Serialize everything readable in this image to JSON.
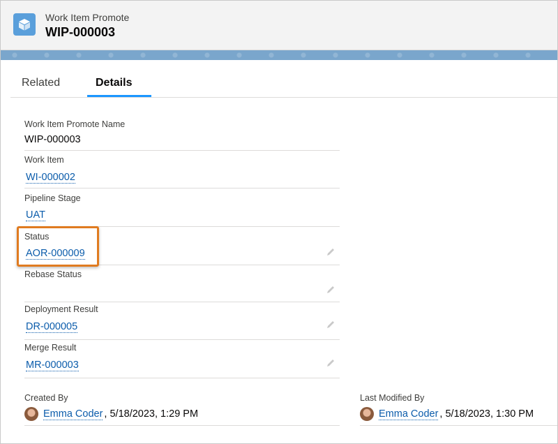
{
  "header": {
    "object_type": "Work Item Promote",
    "record_title": "WIP-000003"
  },
  "tabs": {
    "related": "Related",
    "details": "Details"
  },
  "fields": {
    "name": {
      "label": "Work Item Promote Name",
      "value": "WIP-000003"
    },
    "work_item": {
      "label": "Work Item",
      "value": "WI-000002"
    },
    "pipeline_stage": {
      "label": "Pipeline Stage",
      "value": "UAT"
    },
    "status": {
      "label": "Status",
      "value": "AOR-000009"
    },
    "rebase_status": {
      "label": "Rebase Status",
      "value": ""
    },
    "deployment_result": {
      "label": "Deployment Result",
      "value": "DR-000005"
    },
    "merge_result": {
      "label": "Merge Result",
      "value": "MR-000003"
    }
  },
  "created_by": {
    "label": "Created By",
    "user": "Emma Coder",
    "date": ", 5/18/2023, 1:29 PM"
  },
  "last_modified_by": {
    "label": "Last Modified By",
    "user": "Emma Coder",
    "date": ", 5/18/2023, 1:30 PM"
  },
  "colors": {
    "accent": "#1b96ff",
    "link": "#0b5cab",
    "highlight": "#e07b20",
    "icon_bg": "#5a9fdb"
  },
  "icons": {
    "object": "cube-icon",
    "edit": "pencil-icon",
    "user": "avatar"
  }
}
